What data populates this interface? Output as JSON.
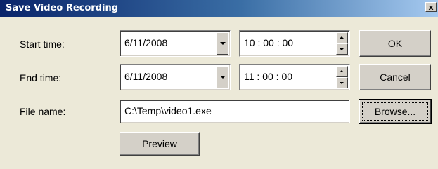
{
  "window": {
    "title": "Save Video Recording",
    "close_glyph": "x"
  },
  "form": {
    "start_label": "Start time:",
    "start_date": "6/11/2008",
    "start_time": "10 : 00 : 00",
    "end_label": "End time:",
    "end_date": "6/11/2008",
    "end_time": "11 : 00 : 00",
    "file_label": "File name:",
    "file_value": "C:\\Temp\\video1.exe"
  },
  "buttons": {
    "ok": "OK",
    "cancel": "Cancel",
    "browse": "Browse...",
    "preview": "Preview"
  },
  "icons": {
    "close": "close-icon",
    "dropdown": "chevron-down-icon",
    "spin_up": "chevron-up-icon",
    "spin_down": "chevron-down-icon"
  },
  "colors": {
    "title_bar_start": "#0a246a",
    "title_bar_end": "#a6caf0",
    "dialog_background": "#ece9d8"
  }
}
